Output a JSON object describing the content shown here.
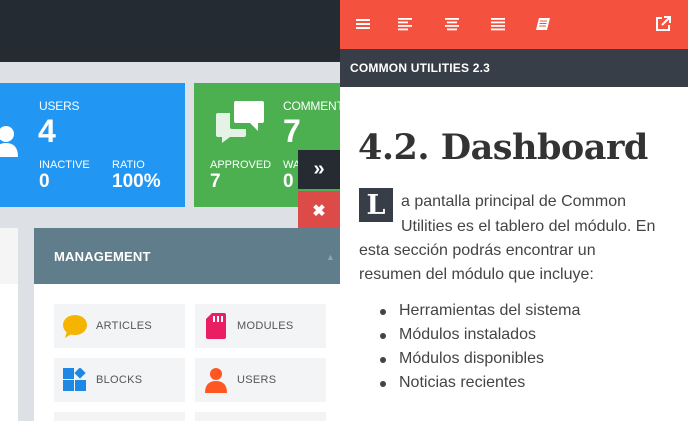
{
  "dashboard": {
    "users_card": {
      "title": "USERS",
      "count": "4",
      "inactive_label": "INACTIVE",
      "inactive_value": "0",
      "ratio_label": "RATIO",
      "ratio_value": "100%"
    },
    "comments_card": {
      "title": "COMMENTS",
      "count": "7",
      "approved_label": "APPROVED",
      "approved_value": "7",
      "waiting_label": "WA",
      "waiting_value": "0"
    },
    "expand_button_icon": "»",
    "close_button_icon": "✖",
    "management": {
      "title": "MANAGEMENT",
      "items": [
        {
          "label": "ARTICLES",
          "icon": "comment-icon",
          "color": "#f4b400"
        },
        {
          "label": "MODULES",
          "icon": "sd-card-icon",
          "color": "#e91e63"
        },
        {
          "label": "BLOCKS",
          "icon": "blocks-icon",
          "color": "#1e88e5"
        },
        {
          "label": "USERS",
          "icon": "user-icon",
          "color": "#ff5722"
        }
      ]
    }
  },
  "help": {
    "toolbar_icons": [
      "menu-icon",
      "align-left-icon",
      "align-center-icon",
      "align-justify-icon",
      "book-icon",
      "external-link-icon"
    ],
    "title": "COMMON UTILITIES 2.3",
    "heading": "4.2. Dashboard",
    "drop_cap": "L",
    "intro_lines": [
      "a pantalla principal de Common",
      "Utilities es el tablero del módulo. En",
      "esta sección podrás encontrar un",
      "resumen del módulo que incluye:"
    ],
    "list": [
      "Herramientas del sistema",
      "Módulos instalados",
      "Módulos disponibles",
      "Noticias recientes"
    ]
  },
  "colors": {
    "accent": "#f4523f",
    "dark": "#373e47",
    "users": "#2196f3",
    "comments": "#4caf50",
    "management": "#607d8b",
    "close": "#dd4b49"
  }
}
